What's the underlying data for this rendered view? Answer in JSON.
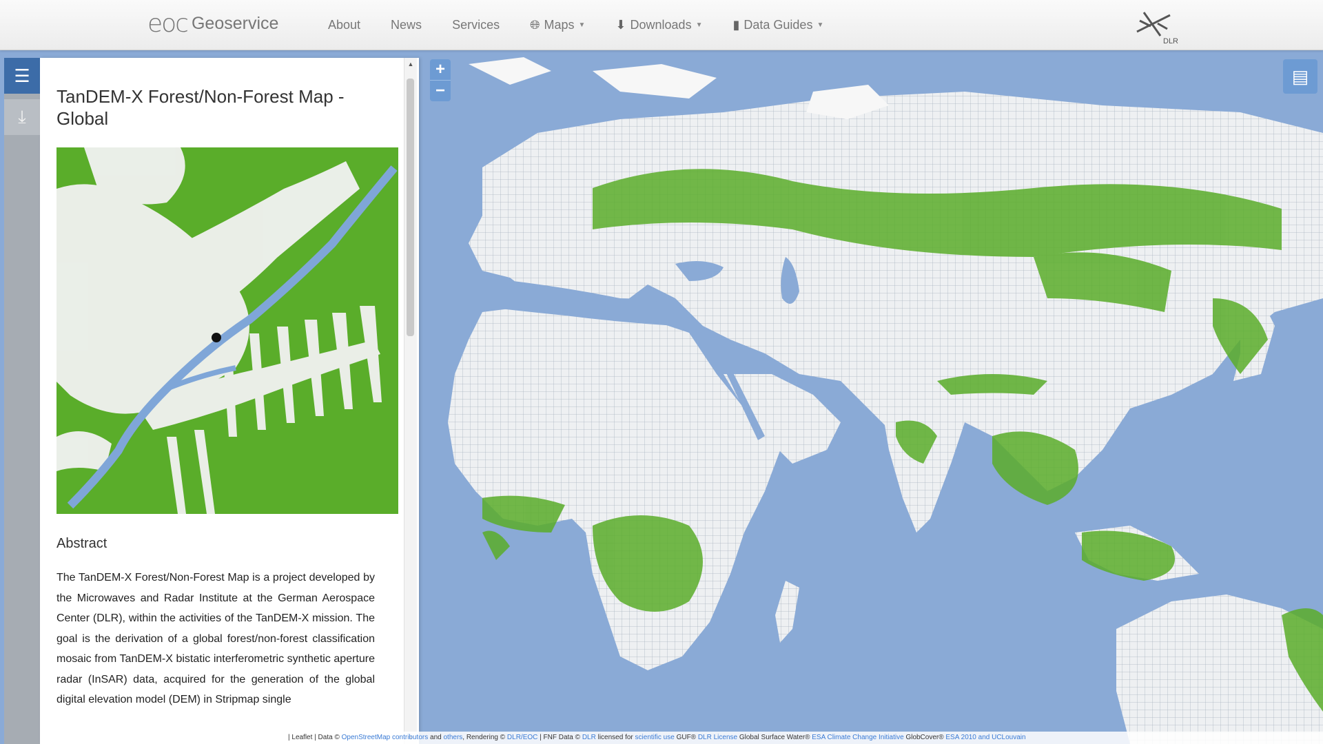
{
  "navbar": {
    "brand_logo": "eoc",
    "brand_name": "Geoservice",
    "links": [
      {
        "label": "About"
      },
      {
        "label": "News"
      },
      {
        "label": "Services"
      },
      {
        "label": "Maps",
        "icon": "globe-icon"
      },
      {
        "label": "Downloads",
        "icon": "download-circle-icon"
      },
      {
        "label": "Data Guides",
        "icon": "book-icon"
      }
    ],
    "partner_logo_text": "DLR"
  },
  "panel": {
    "title": "TanDEM-X Forest/Non-Forest Map - Global",
    "abstract_heading": "Abstract",
    "abstract_text": "The TanDEM-X Forest/Non-Forest Map is a project developed by the Microwaves and Radar Institute at the German Aerospace Center (DLR), within the activities of the TanDEM-X mission. The goal is the derivation of a global forest/non-forest classification mosaic from TanDEM-X bistatic interferometric synthetic aperture radar (InSAR) data, acquired for the generation of the global digital elevation model (DEM) in Stripmap single"
  },
  "map": {
    "zoom_in": "+",
    "zoom_out": "−",
    "attribution": {
      "prefix": "| Leaflet | Data ©",
      "osm": "OpenStreetMap contributors",
      "and": "and",
      "others": "others",
      "rendering": ", Rendering ©",
      "dlr_eoc": "DLR/EOC",
      "fnf_data": "| FNF Data ©",
      "dlr": "DLR",
      "licensed": "licensed for",
      "sci": "scientific use",
      "guf": "GUF®",
      "dlr_license": "DLR License",
      "gsw": "Global Surface Water®",
      "esa_cci": "ESA Climate Change Initiative",
      "globcover": "GlobCover®",
      "esa_ucl": "ESA 2010 and UCLouvain"
    }
  },
  "colors": {
    "ocean": "#8aaad6",
    "land": "#ededed",
    "forest": "#5aad2a",
    "accent": "#3c6ca8"
  }
}
